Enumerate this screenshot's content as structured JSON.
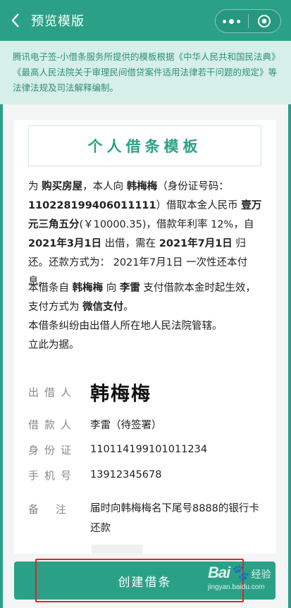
{
  "header": {
    "title": "预览模版"
  },
  "notice": {
    "text": "腾讯电子签-小借条服务所提供的模板根据《中华人民共和国民法典》《最高人民法院关于审理民间借贷案件适用法律若干问题的规定》等法律法规及司法解释编制。"
  },
  "document": {
    "title": "个人借条模板",
    "p1": {
      "t1": "为 ",
      "purpose": "购买房屋",
      "t2": "，本人向 ",
      "lender": "韩梅梅",
      "t3": "（身份证号码：",
      "id": "110228199406011111",
      "t4": "）借取本金人民币 ",
      "amount": "壹万元三角五分",
      "t5": "(￥10000.35)，借款年利率 12%，自 ",
      "start": "2021年3月1日",
      "t6": " 出借，需在 ",
      "end": "2021年7月1日",
      "t7": " 归还。还款方式为： 2021年7月1日 一次性还本付息。"
    },
    "p2": {
      "t1": "本借条自 ",
      "lender": "韩梅梅",
      "t2": " 向 ",
      "borrower": "李雷",
      "t3": " 支付借款本金时起生效，支付方式为 ",
      "method": "微信支付",
      "t4": "。",
      "line2": "本借条纠纷由出借人所在地人民法院管辖。",
      "line3": "立此为据。"
    },
    "fields": {
      "lender_label": "出借人",
      "lender_sign": "韩梅梅",
      "borrower_label": "借款人",
      "borrower_value": "李雷（待签署）",
      "id_label": "身份证",
      "id_value": "110114199101011234",
      "phone_label": "手机号",
      "phone_value": "13912345678",
      "remark_label": "备注",
      "remark_value": "届时向韩梅梅名下尾号8888的银行卡还款"
    }
  },
  "actions": {
    "create_label": "创建借条"
  },
  "watermark": {
    "logo": "Bai",
    "logo2": "经验",
    "url": "jingyan.baidu.com"
  },
  "colors": {
    "accent": "#2aa187",
    "notice_bg": "#d6efe9",
    "highlight": "#e0242a"
  }
}
